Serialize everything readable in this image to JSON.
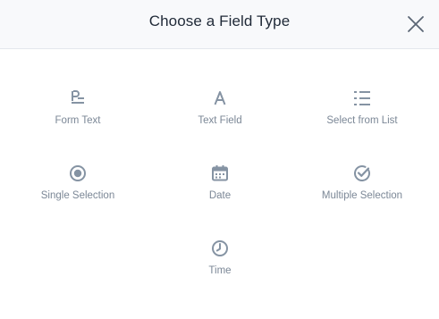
{
  "dialog": {
    "title": "Choose a Field Type",
    "close_icon": "close-icon"
  },
  "field_types": [
    {
      "label": "Form Text",
      "icon": "form-text-icon"
    },
    {
      "label": "Text Field",
      "icon": "text-field-icon"
    },
    {
      "label": "Select from List",
      "icon": "list-icon"
    },
    {
      "label": "Single Selection",
      "icon": "radio-button-icon"
    },
    {
      "label": "Date",
      "icon": "calendar-icon"
    },
    {
      "label": "Multiple Selection",
      "icon": "checkmark-circle-icon"
    },
    {
      "label": "Time",
      "icon": "clock-icon"
    }
  ],
  "colors": {
    "header_bg": "#f8f9fb",
    "title": "#1f2937",
    "icon": "#8593a3",
    "label": "#7b8796"
  }
}
